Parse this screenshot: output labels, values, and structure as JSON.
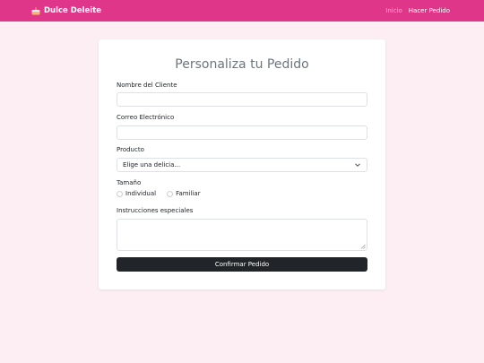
{
  "navbar": {
    "brand": "Dulce Deleite",
    "brand_icon": "cake-icon",
    "links": [
      {
        "label": "Inicio",
        "active": false
      },
      {
        "label": "Hacer Pedido",
        "active": true
      }
    ],
    "color": "#e0368a"
  },
  "form": {
    "title": "Personaliza tu Pedido",
    "fields": {
      "name_label": "Nombre del Cliente",
      "name_value": "",
      "email_label": "Correo Electrónico",
      "email_value": "",
      "product_label": "Producto",
      "product_selected": "Elige una delicia...",
      "size_label": "Tamaño",
      "size_options": [
        "Individual",
        "Familiar"
      ],
      "instructions_label": "Instrucciones especiales",
      "instructions_value": ""
    },
    "submit_label": "Confirmar Pedido"
  },
  "colors": {
    "background": "#fdeef4",
    "button": "#212529"
  }
}
